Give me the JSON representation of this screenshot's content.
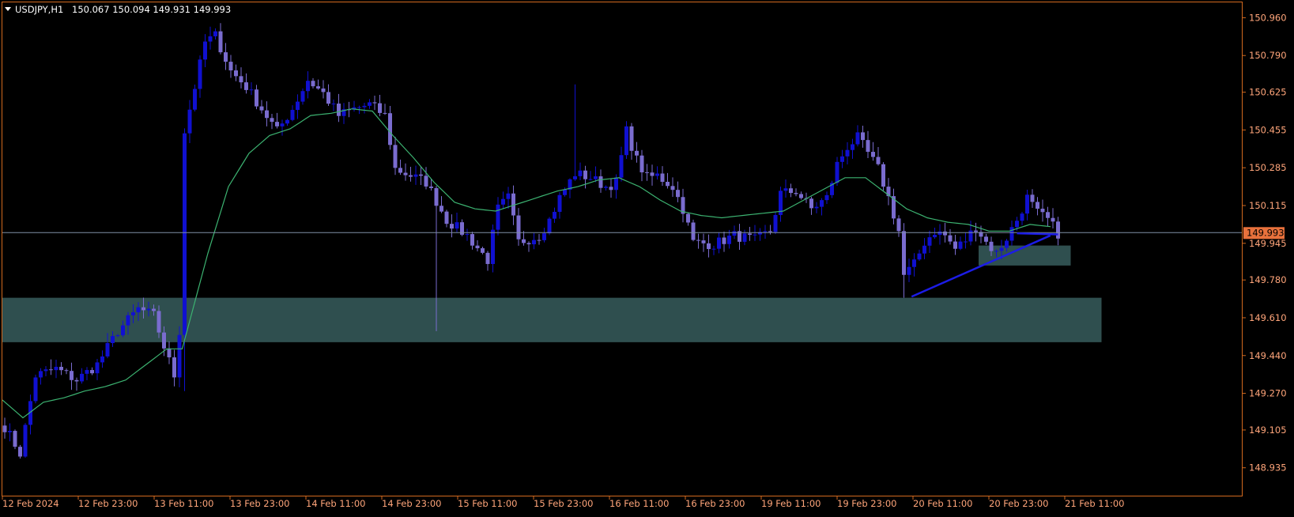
{
  "header": {
    "symbol_timeframe": "USDJPY,H1",
    "ohlc_text": "150.067 150.094 149.931 149.993"
  },
  "colors": {
    "background": "#000000",
    "frame": "#d2691e",
    "axis_text": "#ffa57a",
    "header_text": "#ffffff",
    "bull_candle": "#1010d0",
    "bear_candle": "#7a6ccf",
    "moving_average": "#3cb371",
    "price_line": "#7f8fa6",
    "price_tag_bg": "#e8713c",
    "price_tag_text": "#000000",
    "zone_fill": "#2f4f4f",
    "trendline": "#1c1ce6"
  },
  "chart_data": {
    "type": "candlestick",
    "title": "USDJPY,H1",
    "ylim": [
      148.87,
      150.99
    ],
    "y_ticks": [
      "150.960",
      "150.790",
      "150.625",
      "150.455",
      "150.285",
      "150.115",
      "149.945",
      "149.780",
      "149.610",
      "149.440",
      "149.270",
      "149.105",
      "148.935"
    ],
    "x_ticks": [
      "12 Feb 2024",
      "12 Feb 23:00",
      "13 Feb 11:00",
      "13 Feb 23:00",
      "14 Feb 11:00",
      "14 Feb 23:00",
      "15 Feb 11:00",
      "15 Feb 23:00",
      "16 Feb 11:00",
      "16 Feb 23:00",
      "19 Feb 11:00",
      "19 Feb 23:00",
      "20 Feb 11:00",
      "20 Feb 23:00",
      "21 Feb 11:00"
    ],
    "current_price": "149.993",
    "moving_average": {
      "anchors": [
        [
          0,
          149.24
        ],
        [
          4,
          149.16
        ],
        [
          8,
          149.23
        ],
        [
          12,
          149.25
        ],
        [
          16,
          149.28
        ],
        [
          20,
          149.3
        ],
        [
          24,
          149.33
        ],
        [
          28,
          149.4
        ],
        [
          32,
          149.47
        ],
        [
          35,
          149.47
        ],
        [
          40,
          149.9
        ],
        [
          44,
          150.2
        ],
        [
          48,
          150.35
        ],
        [
          52,
          150.43
        ],
        [
          56,
          150.46
        ],
        [
          60,
          150.52
        ],
        [
          64,
          150.53
        ],
        [
          68,
          150.55
        ],
        [
          72,
          150.54
        ],
        [
          76,
          150.43
        ],
        [
          80,
          150.33
        ],
        [
          84,
          150.22
        ],
        [
          88,
          150.13
        ],
        [
          92,
          150.1
        ],
        [
          96,
          150.09
        ],
        [
          100,
          150.12
        ],
        [
          104,
          150.15
        ],
        [
          108,
          150.18
        ],
        [
          112,
          150.2
        ],
        [
          116,
          150.23
        ],
        [
          120,
          150.24
        ],
        [
          124,
          150.2
        ],
        [
          128,
          150.14
        ],
        [
          132,
          150.09
        ],
        [
          136,
          150.07
        ],
        [
          140,
          150.06
        ],
        [
          144,
          150.07
        ],
        [
          148,
          150.08
        ],
        [
          152,
          150.09
        ],
        [
          156,
          150.14
        ],
        [
          160,
          150.19
        ],
        [
          164,
          150.24
        ],
        [
          168,
          150.24
        ],
        [
          172,
          150.17
        ],
        [
          176,
          150.1
        ],
        [
          180,
          150.06
        ],
        [
          184,
          150.04
        ],
        [
          188,
          150.03
        ],
        [
          192,
          150.0
        ],
        [
          196,
          150.0
        ],
        [
          200,
          150.03
        ],
        [
          204,
          150.02
        ]
      ]
    },
    "close_anchors": [
      [
        0,
        149.12
      ],
      [
        3,
        149.0
      ],
      [
        6,
        149.35
      ],
      [
        10,
        149.38
      ],
      [
        14,
        149.33
      ],
      [
        18,
        149.4
      ],
      [
        22,
        149.55
      ],
      [
        26,
        149.65
      ],
      [
        29,
        149.62
      ],
      [
        31,
        149.48
      ],
      [
        33,
        149.35
      ],
      [
        34,
        149.55
      ],
      [
        35,
        150.45
      ],
      [
        37,
        150.65
      ],
      [
        39,
        150.85
      ],
      [
        41,
        150.88
      ],
      [
        44,
        150.72
      ],
      [
        47,
        150.65
      ],
      [
        50,
        150.55
      ],
      [
        53,
        150.45
      ],
      [
        56,
        150.55
      ],
      [
        59,
        150.68
      ],
      [
        62,
        150.62
      ],
      [
        65,
        150.52
      ],
      [
        68,
        150.55
      ],
      [
        71,
        150.57
      ],
      [
        74,
        150.52
      ],
      [
        76,
        150.28
      ],
      [
        79,
        150.25
      ],
      [
        82,
        150.22
      ],
      [
        86,
        150.05
      ],
      [
        90,
        149.98
      ],
      [
        94,
        149.87
      ],
      [
        96,
        150.1
      ],
      [
        98,
        150.15
      ],
      [
        100,
        149.95
      ],
      [
        104,
        149.98
      ],
      [
        106,
        150.05
      ],
      [
        108,
        150.15
      ],
      [
        111,
        150.26
      ],
      [
        114,
        150.24
      ],
      [
        117,
        150.2
      ],
      [
        119,
        150.22
      ],
      [
        121,
        150.45
      ],
      [
        123,
        150.32
      ],
      [
        125,
        150.24
      ],
      [
        127,
        150.25
      ],
      [
        130,
        150.2
      ],
      [
        132,
        150.1
      ],
      [
        134,
        149.95
      ],
      [
        138,
        149.94
      ],
      [
        142,
        149.98
      ],
      [
        146,
        149.96
      ],
      [
        149,
        150.0
      ],
      [
        151,
        150.17
      ],
      [
        154,
        150.18
      ],
      [
        157,
        150.1
      ],
      [
        160,
        150.15
      ],
      [
        162,
        150.3
      ],
      [
        164,
        150.38
      ],
      [
        166,
        150.42
      ],
      [
        168,
        150.35
      ],
      [
        170,
        150.28
      ],
      [
        172,
        150.15
      ],
      [
        174,
        150.0
      ],
      [
        175,
        149.8
      ],
      [
        177,
        149.85
      ],
      [
        179,
        149.95
      ],
      [
        181,
        150.0
      ],
      [
        183,
        149.98
      ],
      [
        185,
        149.92
      ],
      [
        187,
        149.96
      ],
      [
        189,
        150.02
      ],
      [
        191,
        149.95
      ],
      [
        193,
        149.9
      ],
      [
        195,
        149.97
      ],
      [
        197,
        150.05
      ],
      [
        199,
        150.15
      ],
      [
        201,
        150.08
      ],
      [
        203,
        150.05
      ],
      [
        205,
        149.99
      ]
    ],
    "spikes": [
      [
        35,
        "low",
        149.28
      ],
      [
        84,
        "low",
        149.55
      ],
      [
        111,
        "high",
        150.66
      ],
      [
        175,
        "low",
        149.7
      ]
    ],
    "zones": [
      {
        "from": 149.7,
        "to": 149.5,
        "x_from": 0,
        "x_to": 213
      },
      {
        "from": 149.935,
        "to": 149.845,
        "x_from": 190,
        "x_to": 207
      }
    ],
    "trendlines": [
      {
        "from": [
          176.5,
          149.705
        ],
        "to": [
          203.5,
          149.98
        ]
      },
      {
        "from": [
          197,
          149.99
        ],
        "to": [
          205,
          149.985
        ]
      }
    ]
  }
}
